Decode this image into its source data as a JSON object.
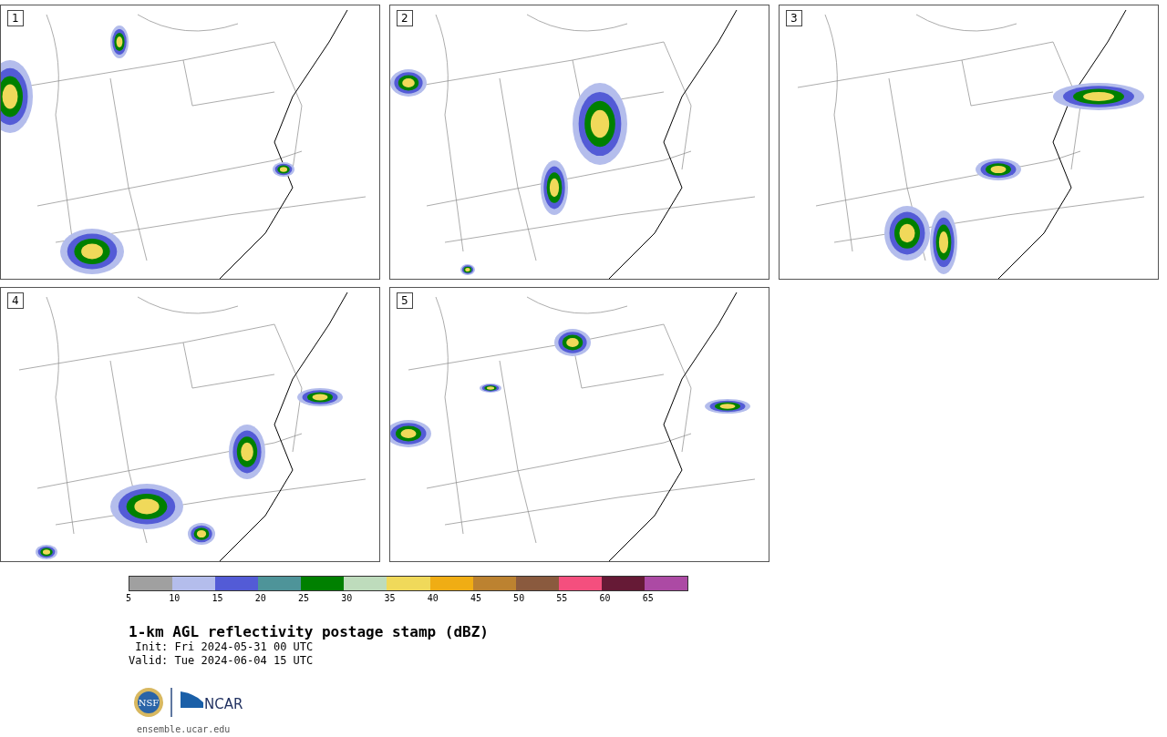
{
  "panels": [
    {
      "label": "1"
    },
    {
      "label": "2"
    },
    {
      "label": "3"
    },
    {
      "label": "4"
    },
    {
      "label": "5"
    }
  ],
  "colorbar": {
    "segments": [
      {
        "color": "#a0a0a0"
      },
      {
        "color": "#b4bdec"
      },
      {
        "color": "#535bd6"
      },
      {
        "color": "#4e9499"
      },
      {
        "color": "#008000"
      },
      {
        "color": "#bedcbc"
      },
      {
        "color": "#f0d95a"
      },
      {
        "color": "#f0ad14"
      },
      {
        "color": "#bc8230"
      },
      {
        "color": "#8a5a3e"
      },
      {
        "color": "#f44f7e"
      },
      {
        "color": "#661a36"
      },
      {
        "color": "#ac4aa4"
      }
    ],
    "ticks": [
      "5",
      "10",
      "15",
      "20",
      "25",
      "30",
      "35",
      "40",
      "45",
      "50",
      "55",
      "60",
      "65"
    ]
  },
  "title": "1-km AGL reflectivity postage stamp (dBZ)",
  "init": " Init: Fri 2024-05-31 00 UTC",
  "valid": "Valid: Tue 2024-06-04 15 UTC",
  "logo": {
    "nsf": "NSF",
    "ncar": "NCAR"
  },
  "url": "ensemble.ucar.edu"
}
